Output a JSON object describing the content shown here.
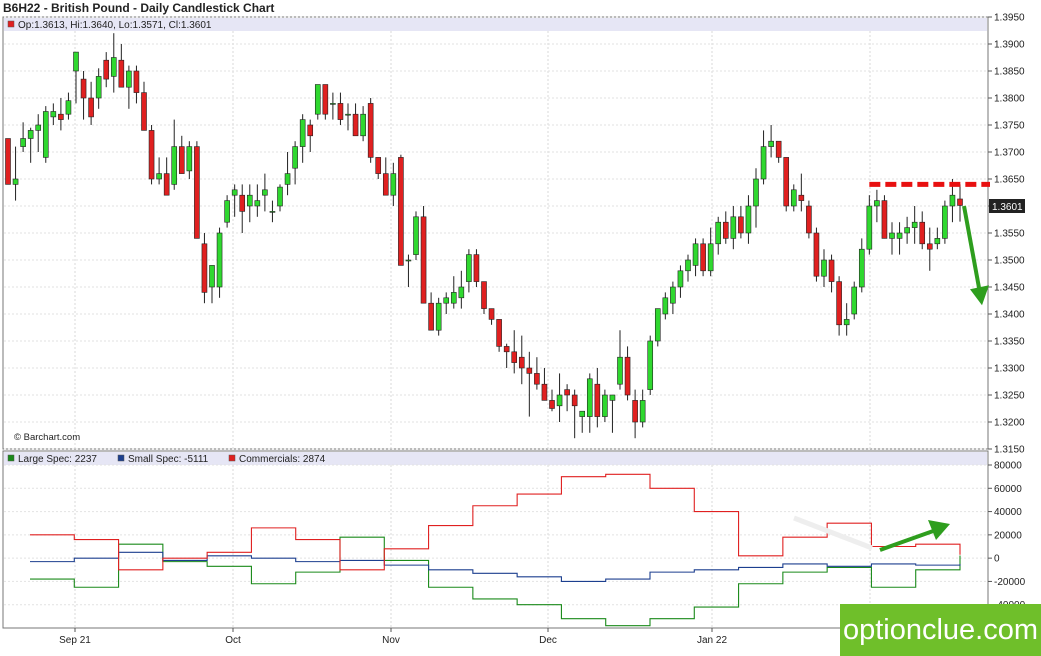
{
  "chart_data": [
    {
      "type": "candlestick",
      "title": "B6H22 - British Pound - Daily Candlestick Chart",
      "ohlc_label": "Op:1.3613, Hi:1.3640, Lo:1.3571, Cl:1.3601",
      "source": "© Barchart.com",
      "last_price_label": "1.3601",
      "ylim": [
        1.315,
        1.395
      ],
      "y_ticks": [
        "1.3950",
        "1.3900",
        "1.3850",
        "1.3800",
        "1.3750",
        "1.3700",
        "1.3650",
        "1.3600",
        "1.3550",
        "1.3500",
        "1.3450",
        "1.3400",
        "1.3350",
        "1.3300",
        "1.3250",
        "1.3200",
        "1.3150"
      ],
      "x_ticks": [
        "Sep 21",
        "Oct",
        "Nov",
        "Dec",
        "Jan 22"
      ],
      "resistance_level": 1.364,
      "colors": {
        "up": "#2fd82f",
        "down": "#e02020",
        "resistance": "#e81010",
        "arrow": "#2e9e1e"
      },
      "candles": [
        [
          1.3725,
          1.3725,
          1.364,
          1.364
        ],
        [
          1.364,
          1.371,
          1.361,
          1.365
        ],
        [
          1.371,
          1.3755,
          1.37,
          1.3725
        ],
        [
          1.3725,
          1.3745,
          1.368,
          1.374
        ],
        [
          1.374,
          1.377,
          1.37,
          1.375
        ],
        [
          1.369,
          1.3785,
          1.368,
          1.3775
        ],
        [
          1.3765,
          1.379,
          1.375,
          1.3775
        ],
        [
          1.377,
          1.38,
          1.374,
          1.376
        ],
        [
          1.377,
          1.381,
          1.376,
          1.3795
        ],
        [
          1.385,
          1.3885,
          1.379,
          1.3885
        ],
        [
          1.3835,
          1.385,
          1.376,
          1.38
        ],
        [
          1.38,
          1.383,
          1.375,
          1.3765
        ],
        [
          1.38,
          1.3855,
          1.378,
          1.384
        ],
        [
          1.387,
          1.3885,
          1.382,
          1.3835
        ],
        [
          1.384,
          1.392,
          1.381,
          1.3875
        ],
        [
          1.387,
          1.39,
          1.382,
          1.382
        ],
        [
          1.382,
          1.386,
          1.378,
          1.385
        ],
        [
          1.385,
          1.386,
          1.379,
          1.381
        ],
        [
          1.381,
          1.383,
          1.374,
          1.374
        ],
        [
          1.374,
          1.375,
          1.364,
          1.365
        ],
        [
          1.365,
          1.369,
          1.364,
          1.366
        ],
        [
          1.366,
          1.369,
          1.362,
          1.362
        ],
        [
          1.364,
          1.376,
          1.363,
          1.371
        ],
        [
          1.371,
          1.373,
          1.366,
          1.366
        ],
        [
          1.3665,
          1.372,
          1.365,
          1.371
        ],
        [
          1.371,
          1.372,
          1.354,
          1.354
        ],
        [
          1.353,
          1.355,
          1.342,
          1.344
        ],
        [
          1.345,
          1.349,
          1.342,
          1.349
        ],
        [
          1.345,
          1.356,
          1.343,
          1.355
        ],
        [
          1.357,
          1.362,
          1.356,
          1.361
        ],
        [
          1.362,
          1.364,
          1.358,
          1.363
        ],
        [
          1.362,
          1.364,
          1.355,
          1.359
        ],
        [
          1.36,
          1.364,
          1.357,
          1.362
        ],
        [
          1.36,
          1.364,
          1.358,
          1.361
        ],
        [
          1.362,
          1.366,
          1.359,
          1.363
        ],
        [
          1.359,
          1.361,
          1.357,
          1.359
        ],
        [
          1.36,
          1.364,
          1.359,
          1.3635
        ],
        [
          1.364,
          1.37,
          1.362,
          1.366
        ],
        [
          1.367,
          1.372,
          1.364,
          1.371
        ],
        [
          1.371,
          1.377,
          1.368,
          1.376
        ],
        [
          1.375,
          1.376,
          1.37,
          1.373
        ],
        [
          1.377,
          1.3825,
          1.376,
          1.3825
        ],
        [
          1.3825,
          1.3825,
          1.376,
          1.377
        ],
        [
          1.379,
          1.381,
          1.376,
          1.379
        ],
        [
          1.379,
          1.381,
          1.375,
          1.376
        ],
        [
          1.377,
          1.379,
          1.374,
          1.377
        ],
        [
          1.377,
          1.379,
          1.373,
          1.373
        ],
        [
          1.373,
          1.3785,
          1.372,
          1.377
        ],
        [
          1.379,
          1.38,
          1.368,
          1.369
        ],
        [
          1.369,
          1.369,
          1.365,
          1.366
        ],
        [
          1.366,
          1.369,
          1.362,
          1.362
        ],
        [
          1.362,
          1.368,
          1.36,
          1.366
        ],
        [
          1.369,
          1.3695,
          1.349,
          1.349
        ],
        [
          1.35,
          1.351,
          1.345,
          1.35
        ],
        [
          1.351,
          1.359,
          1.35,
          1.358
        ],
        [
          1.358,
          1.36,
          1.342,
          1.342
        ],
        [
          1.342,
          1.344,
          1.337,
          1.337
        ],
        [
          1.337,
          1.343,
          1.336,
          1.342
        ],
        [
          1.342,
          1.344,
          1.34,
          1.343
        ],
        [
          1.342,
          1.347,
          1.341,
          1.344
        ],
        [
          1.343,
          1.348,
          1.341,
          1.345
        ],
        [
          1.346,
          1.352,
          1.344,
          1.351
        ],
        [
          1.351,
          1.352,
          1.345,
          1.346
        ],
        [
          1.346,
          1.346,
          1.34,
          1.341
        ],
        [
          1.341,
          1.341,
          1.338,
          1.339
        ],
        [
          1.339,
          1.339,
          1.333,
          1.334
        ],
        [
          1.334,
          1.3345,
          1.33,
          1.333
        ],
        [
          1.333,
          1.337,
          1.329,
          1.331
        ],
        [
          1.332,
          1.336,
          1.327,
          1.33
        ],
        [
          1.33,
          1.333,
          1.321,
          1.329
        ],
        [
          1.329,
          1.332,
          1.326,
          1.327
        ],
        [
          1.327,
          1.33,
          1.324,
          1.324
        ],
        [
          1.324,
          1.326,
          1.322,
          1.3225
        ],
        [
          1.323,
          1.329,
          1.32,
          1.325
        ],
        [
          1.326,
          1.327,
          1.322,
          1.325
        ],
        [
          1.325,
          1.326,
          1.317,
          1.323
        ],
        [
          1.321,
          1.322,
          1.318,
          1.322
        ],
        [
          1.321,
          1.329,
          1.318,
          1.328
        ],
        [
          1.327,
          1.33,
          1.319,
          1.321
        ],
        [
          1.321,
          1.326,
          1.32,
          1.325
        ],
        [
          1.324,
          1.325,
          1.318,
          1.325
        ],
        [
          1.327,
          1.337,
          1.326,
          1.332
        ],
        [
          1.332,
          1.334,
          1.324,
          1.325
        ],
        [
          1.324,
          1.326,
          1.317,
          1.32
        ],
        [
          1.32,
          1.326,
          1.319,
          1.324
        ],
        [
          1.326,
          1.336,
          1.325,
          1.335
        ],
        [
          1.335,
          1.341,
          1.334,
          1.341
        ],
        [
          1.34,
          1.344,
          1.339,
          1.343
        ],
        [
          1.342,
          1.346,
          1.34,
          1.345
        ],
        [
          1.345,
          1.349,
          1.343,
          1.348
        ],
        [
          1.348,
          1.351,
          1.346,
          1.35
        ],
        [
          1.349,
          1.354,
          1.347,
          1.353
        ],
        [
          1.353,
          1.354,
          1.347,
          1.348
        ],
        [
          1.348,
          1.356,
          1.347,
          1.353
        ],
        [
          1.353,
          1.358,
          1.351,
          1.357
        ],
        [
          1.357,
          1.359,
          1.353,
          1.354
        ],
        [
          1.354,
          1.36,
          1.352,
          1.358
        ],
        [
          1.358,
          1.36,
          1.354,
          1.355
        ],
        [
          1.355,
          1.362,
          1.353,
          1.36
        ],
        [
          1.36,
          1.367,
          1.356,
          1.365
        ],
        [
          1.365,
          1.374,
          1.364,
          1.371
        ],
        [
          1.371,
          1.375,
          1.369,
          1.372
        ],
        [
          1.372,
          1.372,
          1.368,
          1.369
        ],
        [
          1.369,
          1.369,
          1.359,
          1.36
        ],
        [
          1.36,
          1.364,
          1.359,
          1.363
        ],
        [
          1.362,
          1.366,
          1.359,
          1.361
        ],
        [
          1.36,
          1.361,
          1.354,
          1.355
        ],
        [
          1.355,
          1.356,
          1.346,
          1.347
        ],
        [
          1.347,
          1.352,
          1.345,
          1.35
        ],
        [
          1.35,
          1.351,
          1.344,
          1.346
        ],
        [
          1.346,
          1.347,
          1.336,
          1.338
        ],
        [
          1.338,
          1.342,
          1.336,
          1.339
        ],
        [
          1.34,
          1.346,
          1.339,
          1.345
        ],
        [
          1.345,
          1.354,
          1.344,
          1.352
        ],
        [
          1.352,
          1.362,
          1.351,
          1.36
        ],
        [
          1.36,
          1.363,
          1.357,
          1.361
        ],
        [
          1.361,
          1.362,
          1.354,
          1.354
        ],
        [
          1.354,
          1.357,
          1.351,
          1.355
        ],
        [
          1.354,
          1.357,
          1.351,
          1.355
        ],
        [
          1.355,
          1.358,
          1.353,
          1.356
        ],
        [
          1.356,
          1.36,
          1.353,
          1.357
        ],
        [
          1.357,
          1.359,
          1.352,
          1.353
        ],
        [
          1.353,
          1.356,
          1.348,
          1.352
        ],
        [
          1.353,
          1.356,
          1.352,
          1.354
        ],
        [
          1.354,
          1.361,
          1.353,
          1.36
        ],
        [
          1.36,
          1.365,
          1.357,
          1.362
        ],
        [
          1.3613,
          1.364,
          1.3571,
          1.3601
        ]
      ]
    },
    {
      "type": "step-line",
      "y_ticks": [
        "80000",
        "60000",
        "40000",
        "20000",
        "0",
        "-20000",
        "-40000"
      ],
      "ylim": [
        -60000,
        80000
      ],
      "series": [
        {
          "name": "Large Spec: 2237",
          "color": "#1a8a1a",
          "values": [
            -18000,
            -18000,
            -25000,
            -25000,
            12000,
            12000,
            -3000,
            -3000,
            -7000,
            -7000,
            -22000,
            -22000,
            -12000,
            -12000,
            18000,
            18000,
            -2000,
            -2000,
            -25000,
            -25000,
            -35000,
            -35000,
            -40000,
            -40000,
            -52000,
            -52000,
            -58000,
            -58000,
            -52000,
            -52000,
            -42000,
            -42000,
            -22000,
            -22000,
            -12000,
            -12000,
            -8000,
            -8000,
            -25000,
            -25000,
            -10000,
            -10000,
            2237
          ]
        },
        {
          "name": "Small Spec: -5111",
          "color": "#1c3f8f",
          "values": [
            -3000,
            -3000,
            0,
            0,
            5000,
            5000,
            -2000,
            -2000,
            2000,
            2000,
            0,
            0,
            -3000,
            -3000,
            -2000,
            -2000,
            -6000,
            -6000,
            -10000,
            -10000,
            -13000,
            -13000,
            -16000,
            -16000,
            -20000,
            -20000,
            -18000,
            -18000,
            -12000,
            -12000,
            -10000,
            -10000,
            -8000,
            -8000,
            -5000,
            -5000,
            -7000,
            -7000,
            -5000,
            -5000,
            -6000,
            -6000,
            -5111
          ]
        },
        {
          "name": "Commercials: 2874",
          "color": "#e02020",
          "values": [
            20000,
            20000,
            16000,
            16000,
            -10000,
            -10000,
            0,
            0,
            5000,
            5000,
            26000,
            26000,
            16000,
            16000,
            -10000,
            -10000,
            8000,
            8000,
            28000,
            28000,
            45000,
            45000,
            55000,
            55000,
            70000,
            70000,
            72000,
            72000,
            60000,
            60000,
            40000,
            40000,
            2000,
            2000,
            18000,
            18000,
            30000,
            30000,
            10000,
            10000,
            12000,
            12000,
            2874
          ]
        }
      ]
    }
  ],
  "watermark": "optionclue.com"
}
